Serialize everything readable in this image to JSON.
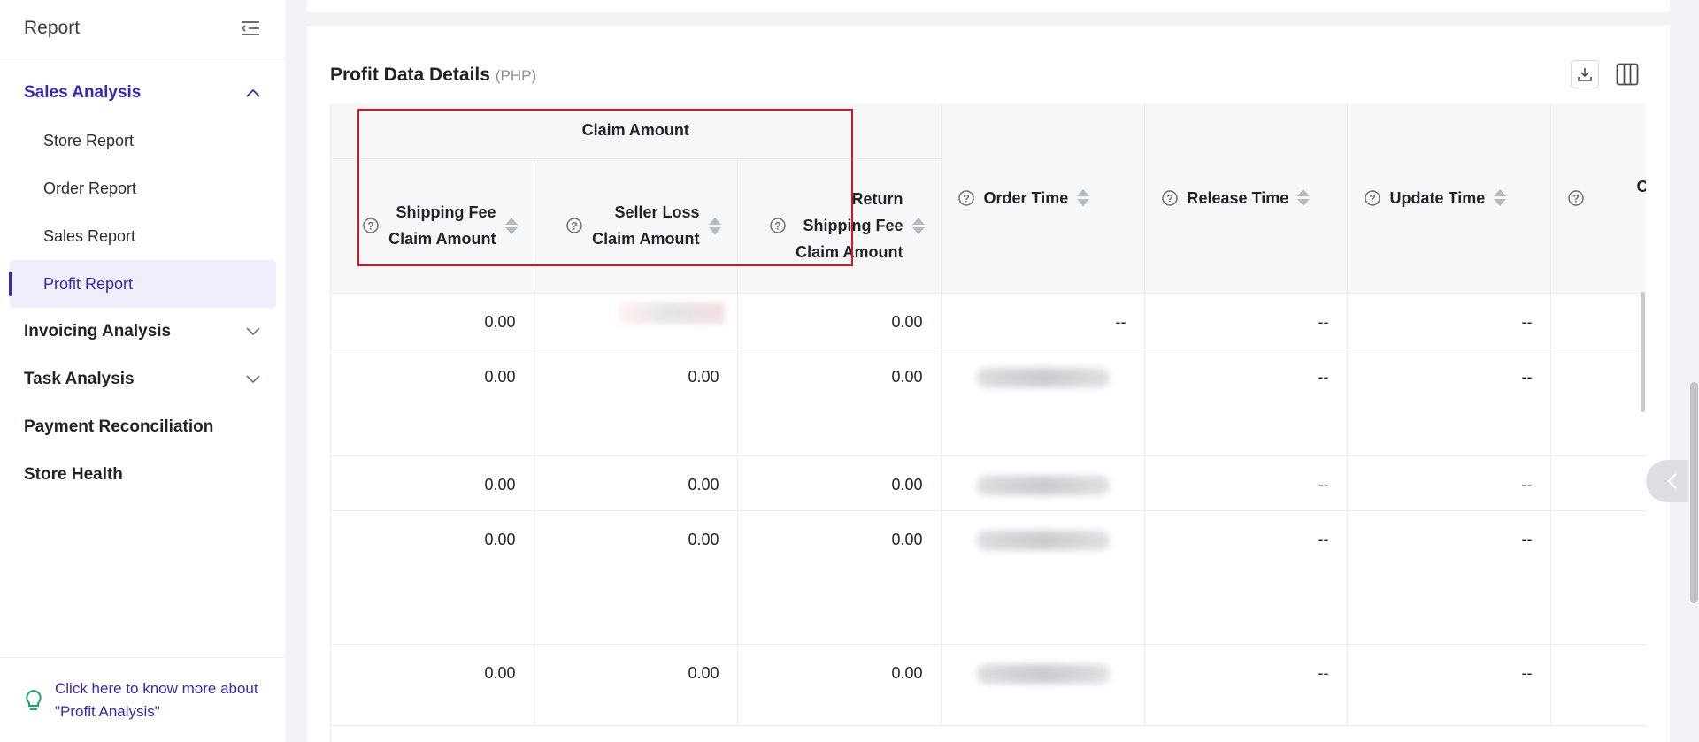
{
  "sidebar": {
    "title": "Report",
    "groups": [
      {
        "label": "Sales Analysis",
        "expanded": true,
        "items": [
          {
            "label": "Store Report"
          },
          {
            "label": "Order Report"
          },
          {
            "label": "Sales Report"
          },
          {
            "label": "Profit Report",
            "selected": true
          }
        ]
      },
      {
        "label": "Invoicing Analysis",
        "expanded": false
      },
      {
        "label": "Task Analysis",
        "expanded": false
      },
      {
        "label": "Payment Reconciliation"
      },
      {
        "label": "Store Health"
      }
    ],
    "help_line1": "Click here to know more about",
    "help_line2": "\"Profit Analysis\""
  },
  "main": {
    "title": "Profit Data Details",
    "currency": "(PHP)"
  },
  "table": {
    "group_header": "Claim Amount",
    "columns": {
      "shipping_line1": "Shipping Fee",
      "shipping_line2": "Claim Amount",
      "seller_line1": "Seller Loss",
      "seller_line2": "Claim Amount",
      "return_line1": "Return",
      "return_line2": "Shipping Fee",
      "return_line3": "Claim Amount",
      "order_time": "Order Time",
      "release_time": "Release Time",
      "update_time": "Update Time",
      "partial": "Co"
    },
    "rows": [
      {
        "shipping": "0.00",
        "seller": "",
        "return": "0.00",
        "order_time": "--",
        "release_time": "--",
        "update_time": "--"
      },
      {
        "shipping": "0.00",
        "seller": "0.00",
        "return": "0.00",
        "order_time": "",
        "release_time": "--",
        "update_time": "--"
      },
      {
        "shipping": "0.00",
        "seller": "0.00",
        "return": "0.00",
        "order_time": "",
        "release_time": "--",
        "update_time": "--"
      },
      {
        "shipping": "0.00",
        "seller": "0.00",
        "return": "0.00",
        "order_time": "",
        "release_time": "--",
        "update_time": "--"
      },
      {
        "shipping": "0.00",
        "seller": "0.00",
        "return": "0.00",
        "order_time": "",
        "release_time": "--",
        "update_time": "--"
      }
    ]
  },
  "colors": {
    "accent": "#3d27b0",
    "highlight": "#e0141e"
  }
}
